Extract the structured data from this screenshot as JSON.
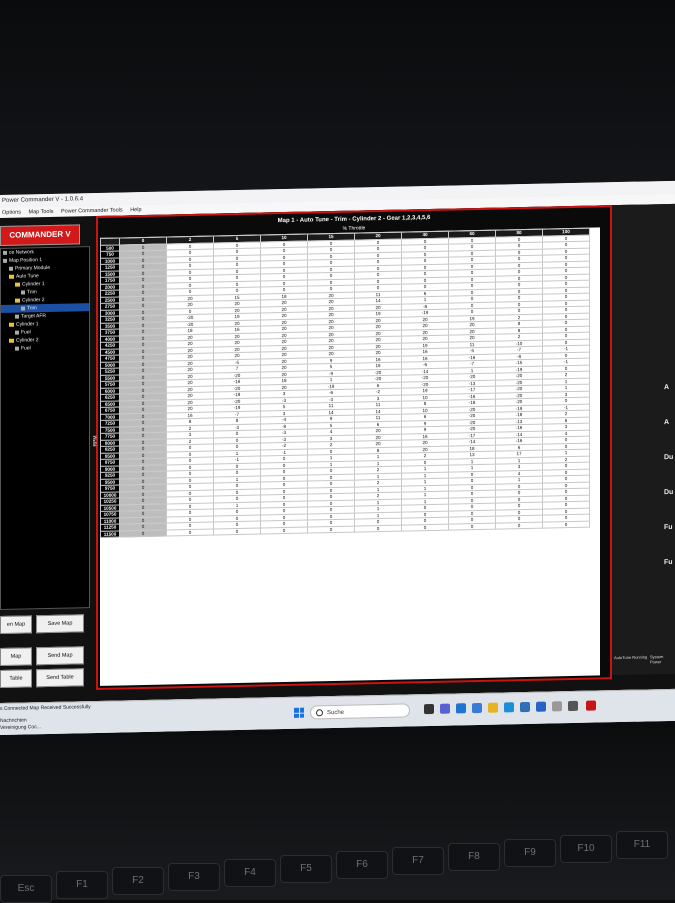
{
  "window": {
    "title": "Power Commander V - 1.0.6.4"
  },
  "menu": [
    "Options",
    "Map Tools",
    "Power Commander Tools",
    "Help"
  ],
  "logo": "COMMANDER V",
  "tree": [
    {
      "label": "ce Network",
      "indent": 0,
      "type": "leaf"
    },
    {
      "label": "Map Position 1",
      "indent": 0,
      "type": "leaf"
    },
    {
      "label": "Primary Module",
      "indent": 1,
      "type": "leaf"
    },
    {
      "label": "Auto Tune",
      "indent": 1,
      "type": "folder"
    },
    {
      "label": "Cylinder 1",
      "indent": 2,
      "type": "folder"
    },
    {
      "label": "Trim",
      "indent": 3,
      "type": "leaf"
    },
    {
      "label": "Cylinder 2",
      "indent": 2,
      "type": "folder"
    },
    {
      "label": "Trim",
      "indent": 3,
      "type": "leaf",
      "selected": true
    },
    {
      "label": "Target AFR",
      "indent": 2,
      "type": "leaf"
    },
    {
      "label": "Cylinder 1",
      "indent": 1,
      "type": "folder"
    },
    {
      "label": "Fuel",
      "indent": 2,
      "type": "leaf"
    },
    {
      "label": "Cylinder 2",
      "indent": 1,
      "type": "folder"
    },
    {
      "label": "Fuel",
      "indent": 2,
      "type": "leaf"
    }
  ],
  "buttons": {
    "open_map": "en Map",
    "save_map": "Save Map",
    "get_map": "Map",
    "send_map": "Send Map",
    "get_table": "Table",
    "send_table": "Send Table"
  },
  "map": {
    "title": "Map 1 - Auto Tune - Trim - Cylinder 2 - Gear 1,2,3,4,5,6",
    "axis_label": "% Throttle",
    "rpm_label": "RPM",
    "columns": [
      "0",
      "2",
      "5",
      "10",
      "15",
      "20",
      "40",
      "60",
      "80",
      "100"
    ],
    "rows": [
      {
        "rpm": "500",
        "v": [
          "0",
          "0",
          "0",
          "0",
          "0",
          "0",
          "0",
          "0",
          "0",
          "0"
        ]
      },
      {
        "rpm": "750",
        "v": [
          "0",
          "0",
          "0",
          "0",
          "0",
          "0",
          "0",
          "0",
          "0",
          "0"
        ]
      },
      {
        "rpm": "1000",
        "v": [
          "0",
          "0",
          "0",
          "0",
          "0",
          "0",
          "0",
          "0",
          "0",
          "0"
        ]
      },
      {
        "rpm": "1250",
        "v": [
          "0",
          "0",
          "0",
          "0",
          "0",
          "0",
          "0",
          "0",
          "0",
          "0"
        ]
      },
      {
        "rpm": "1500",
        "v": [
          "0",
          "0",
          "0",
          "0",
          "0",
          "0",
          "0",
          "0",
          "0",
          "0"
        ]
      },
      {
        "rpm": "1750",
        "v": [
          "0",
          "0",
          "0",
          "0",
          "0",
          "0",
          "0",
          "0",
          "0",
          "0"
        ]
      },
      {
        "rpm": "2000",
        "v": [
          "0",
          "0",
          "0",
          "0",
          "0",
          "0",
          "0",
          "0",
          "0",
          "0"
        ]
      },
      {
        "rpm": "2250",
        "v": [
          "0",
          "0",
          "0",
          "0",
          "0",
          "0",
          "0",
          "0",
          "0",
          "0"
        ]
      },
      {
        "rpm": "2500",
        "v": [
          "0",
          "20",
          "15",
          "18",
          "20",
          "11",
          "6",
          "0",
          "0",
          "0"
        ]
      },
      {
        "rpm": "2750",
        "v": [
          "0",
          "20",
          "20",
          "20",
          "20",
          "14",
          "1",
          "0",
          "0",
          "0"
        ]
      },
      {
        "rpm": "3000",
        "v": [
          "0",
          "0",
          "20",
          "20",
          "20",
          "20",
          "-8",
          "0",
          "0",
          "0"
        ]
      },
      {
        "rpm": "3250",
        "v": [
          "0",
          "-20",
          "19",
          "20",
          "20",
          "19",
          "-19",
          "0",
          "0",
          "0"
        ]
      },
      {
        "rpm": "3500",
        "v": [
          "0",
          "-20",
          "20",
          "20",
          "20",
          "20",
          "20",
          "19",
          "2",
          "0"
        ]
      },
      {
        "rpm": "3750",
        "v": [
          "0",
          "18",
          "16",
          "20",
          "20",
          "20",
          "20",
          "20",
          "8",
          "0"
        ]
      },
      {
        "rpm": "4000",
        "v": [
          "0",
          "20",
          "20",
          "20",
          "20",
          "20",
          "20",
          "20",
          "8",
          "0"
        ]
      },
      {
        "rpm": "4250",
        "v": [
          "0",
          "20",
          "20",
          "20",
          "20",
          "20",
          "20",
          "20",
          "2",
          "0"
        ]
      },
      {
        "rpm": "4500",
        "v": [
          "0",
          "20",
          "20",
          "20",
          "20",
          "20",
          "19",
          "11",
          "-10",
          "0"
        ]
      },
      {
        "rpm": "4750",
        "v": [
          "0",
          "20",
          "20",
          "20",
          "20",
          "20",
          "16",
          "-5",
          "-7",
          "-1"
        ]
      },
      {
        "rpm": "5000",
        "v": [
          "0",
          "20",
          "-5",
          "20",
          "9",
          "16",
          "16",
          "-16",
          "-8",
          "0"
        ]
      },
      {
        "rpm": "5250",
        "v": [
          "0",
          "20",
          "7",
          "20",
          "5",
          "16",
          "-6",
          "-7",
          "-15",
          "-1"
        ]
      },
      {
        "rpm": "5500",
        "v": [
          "0",
          "20",
          "-20",
          "20",
          "-9",
          "-20",
          "-14",
          "1",
          "-19",
          "0"
        ]
      },
      {
        "rpm": "5750",
        "v": [
          "0",
          "20",
          "-16",
          "18",
          "1",
          "-20",
          "-20",
          "-20",
          "-20",
          "2"
        ]
      },
      {
        "rpm": "6000",
        "v": [
          "0",
          "20",
          "-20",
          "20",
          "-19",
          "6",
          "-20",
          "-13",
          "-20",
          "1"
        ]
      },
      {
        "rpm": "6250",
        "v": [
          "0",
          "20",
          "-18",
          "3",
          "-6",
          "-2",
          "19",
          "-17",
          "-20",
          "1"
        ]
      },
      {
        "rpm": "6500",
        "v": [
          "0",
          "20",
          "-20",
          "-3",
          "-3",
          "3",
          "10",
          "-16",
          "-20",
          "3"
        ]
      },
      {
        "rpm": "6750",
        "v": [
          "0",
          "20",
          "-19",
          "5",
          "11",
          "11",
          "8",
          "-18",
          "-20",
          "0"
        ]
      },
      {
        "rpm": "7000",
        "v": [
          "0",
          "16",
          "-7",
          "3",
          "14",
          "14",
          "10",
          "-20",
          "-19",
          "-1"
        ]
      },
      {
        "rpm": "7250",
        "v": [
          "0",
          "8",
          "8",
          "-4",
          "9",
          "11",
          "6",
          "-20",
          "-18",
          "2"
        ]
      },
      {
        "rpm": "7500",
        "v": [
          "0",
          "2",
          "-3",
          "-8",
          "5",
          "6",
          "9",
          "-20",
          "-13",
          "6"
        ]
      },
      {
        "rpm": "7750",
        "v": [
          "0",
          "3",
          "0",
          "-3",
          "4",
          "20",
          "9",
          "-20",
          "-16",
          "3"
        ]
      },
      {
        "rpm": "8000",
        "v": [
          "0",
          "2",
          "0",
          "-3",
          "3",
          "20",
          "16",
          "-17",
          "-14",
          "4"
        ]
      },
      {
        "rpm": "8250",
        "v": [
          "0",
          "0",
          "0",
          "-2",
          "2",
          "20",
          "20",
          "-14",
          "-16",
          "0"
        ]
      },
      {
        "rpm": "8500",
        "v": [
          "0",
          "0",
          "1",
          "-1",
          "0",
          "8",
          "20",
          "18",
          "6",
          "0"
        ]
      },
      {
        "rpm": "8750",
        "v": [
          "0",
          "0",
          "-1",
          "0",
          "1",
          "1",
          "2",
          "13",
          "17",
          "1"
        ]
      },
      {
        "rpm": "9000",
        "v": [
          "0",
          "0",
          "0",
          "0",
          "1",
          "1",
          "0",
          "1",
          "1",
          "2"
        ]
      },
      {
        "rpm": "9250",
        "v": [
          "0",
          "0",
          "0",
          "0",
          "0",
          "2",
          "1",
          "1",
          "3",
          "0"
        ]
      },
      {
        "rpm": "9500",
        "v": [
          "0",
          "0",
          "1",
          "0",
          "0",
          "1",
          "1",
          "0",
          "4",
          "0"
        ]
      },
      {
        "rpm": "9750",
        "v": [
          "0",
          "0",
          "0",
          "0",
          "0",
          "2",
          "1",
          "0",
          "1",
          "0"
        ]
      },
      {
        "rpm": "10000",
        "v": [
          "0",
          "0",
          "0",
          "0",
          "0",
          "1",
          "1",
          "0",
          "0",
          "0"
        ]
      },
      {
        "rpm": "10250",
        "v": [
          "0",
          "0",
          "0",
          "0",
          "0",
          "2",
          "1",
          "0",
          "0",
          "0"
        ]
      },
      {
        "rpm": "10500",
        "v": [
          "0",
          "0",
          "1",
          "0",
          "0",
          "1",
          "1",
          "0",
          "0",
          "0"
        ]
      },
      {
        "rpm": "10750",
        "v": [
          "0",
          "0",
          "0",
          "0",
          "0",
          "1",
          "0",
          "0",
          "0",
          "0"
        ]
      },
      {
        "rpm": "11000",
        "v": [
          "0",
          "0",
          "0",
          "0",
          "0",
          "1",
          "0",
          "0",
          "0",
          "0"
        ]
      },
      {
        "rpm": "11250",
        "v": [
          "0",
          "0",
          "0",
          "0",
          "0",
          "0",
          "0",
          "0",
          "0",
          "0"
        ]
      },
      {
        "rpm": "11500",
        "v": [
          "0",
          "0",
          "0",
          "0",
          "0",
          "0",
          "0",
          "0",
          "0",
          "0"
        ]
      }
    ]
  },
  "right_labels": [
    "A",
    "A",
    "Du",
    "Du",
    "Fu",
    "Fu"
  ],
  "status_icons": {
    "autotune": "AutoTune Running",
    "system": "System Power"
  },
  "statusbar": {
    "text": "s Connected  Map Received Successfully"
  },
  "notifications": {
    "line1": "Nachrichten",
    "line2": "Vereinigung Coc..."
  },
  "taskbar": {
    "search_placeholder": "Suche"
  },
  "keys": [
    "Esc",
    "F1",
    "F2",
    "F3",
    "F4",
    "F5",
    "F6",
    "F7",
    "F8",
    "F9",
    "F10",
    "F11"
  ]
}
